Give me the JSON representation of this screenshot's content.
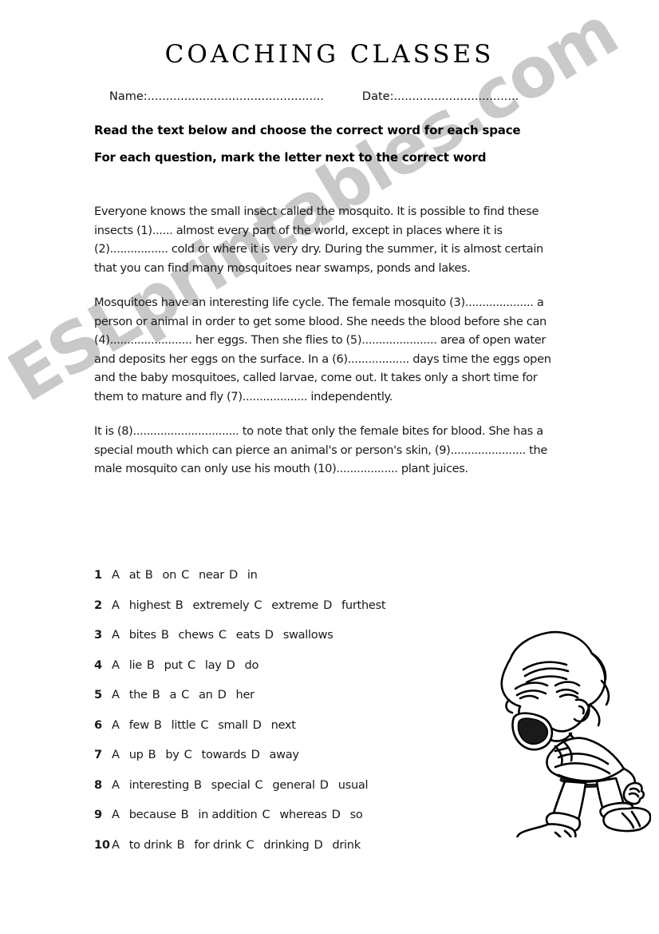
{
  "page": {
    "title": "COACHING CLASSES",
    "watermark": "ESLprintables.com",
    "watermark_color": "#c9c9c9",
    "background_color": "#ffffff",
    "text_color": "#1a1a1a"
  },
  "header": {
    "name_label": "Name:................................................",
    "date_label": "Date:.................................."
  },
  "instructions": {
    "line1": "Read the text below and choose the correct word for each space",
    "line2": "For each question, mark the letter next to the correct word"
  },
  "passage": {
    "paragraphs": [
      "Everyone knows the small insect called the mosquito. It is possible to find these insects (1)...... almost every part of the world, except in places where it is (2)................. cold or where it is very dry. During the summer, it is almost certain that you can find many mosquitoes near swamps, ponds and lakes.",
      "Mosquitoes have an interesting life cycle. The female mosquito (3).................... a person or animal in order to get some blood. She needs the blood  before she can (4)........................ her eggs.  Then she flies to (5)...................... area of open water  and deposits her eggs on the surface. In a (6).................. days time the eggs open and the baby mosquitoes, called larvae, come out. It takes only a short time for them to mature and fly (7)................... independently.",
      "It is (8)............................... to note that only the female bites for blood. She has a special mouth which can pierce an animal's or person's skin, (9)...................... the male mosquito can only use his mouth (10).................. plant juices."
    ]
  },
  "questions": [
    {
      "number": "1",
      "a_letter": "A",
      "a": "at",
      "b_letter": "B",
      "b": "on",
      "c_letter": "C",
      "c": "near",
      "d_letter": "D",
      "d": "in"
    },
    {
      "number": "2",
      "a_letter": "A",
      "a": "highest",
      "b_letter": "B",
      "b": "extremely",
      "c_letter": "C",
      "c": "extreme",
      "d_letter": "D",
      "d": "furthest"
    },
    {
      "number": "3",
      "a_letter": "A",
      "a": "bites",
      "b_letter": "B",
      "b": "chews",
      "c_letter": "C",
      "c": "eats",
      "d_letter": "D",
      "d": "swallows"
    },
    {
      "number": "4",
      "a_letter": "A",
      "a": "lie",
      "b_letter": "B",
      "b": "put",
      "c_letter": "C",
      "c": "lay",
      "d_letter": "D",
      "d": "do"
    },
    {
      "number": "5",
      "a_letter": "A",
      "a": "the",
      "b_letter": "B",
      "b": "a",
      "c_letter": "C",
      "c": "an",
      "d_letter": "D",
      "d": "her"
    },
    {
      "number": "6",
      "a_letter": "A",
      "a": "few",
      "b_letter": "B",
      "b": "little",
      "c_letter": "C",
      "c": "small",
      "d_letter": "D",
      "d": "next"
    },
    {
      "number": "7",
      "a_letter": "A",
      "a": "up",
      "b_letter": "B",
      "b": "by",
      "c_letter": "C",
      "c": "towards",
      "d_letter": "D",
      "d": "away"
    },
    {
      "number": "8",
      "a_letter": "A",
      "a": "interesting",
      "b_letter": "B",
      "b": "special",
      "c_letter": "C",
      "c": "general",
      "d_letter": "D",
      "d": "usual"
    },
    {
      "number": "9",
      "a_letter": "A",
      "a": "because",
      "b_letter": "B",
      "b": "in addition",
      "c_letter": "C",
      "c": "whereas",
      "d_letter": "D",
      "d": "so"
    },
    {
      "number": "10",
      "a_letter": "A",
      "a": "to drink",
      "b_letter": "B",
      "b": "for drink",
      "c_letter": "C",
      "c": "drinking",
      "d_letter": "D",
      "d": "drink"
    }
  ],
  "illustration": {
    "name": "shouting-boy-cartoon",
    "description": "Black and white line-art cartoon of a boy bent forward shouting with mouth wide open",
    "line_color": "#000000",
    "fill_color": "#ffffff"
  }
}
